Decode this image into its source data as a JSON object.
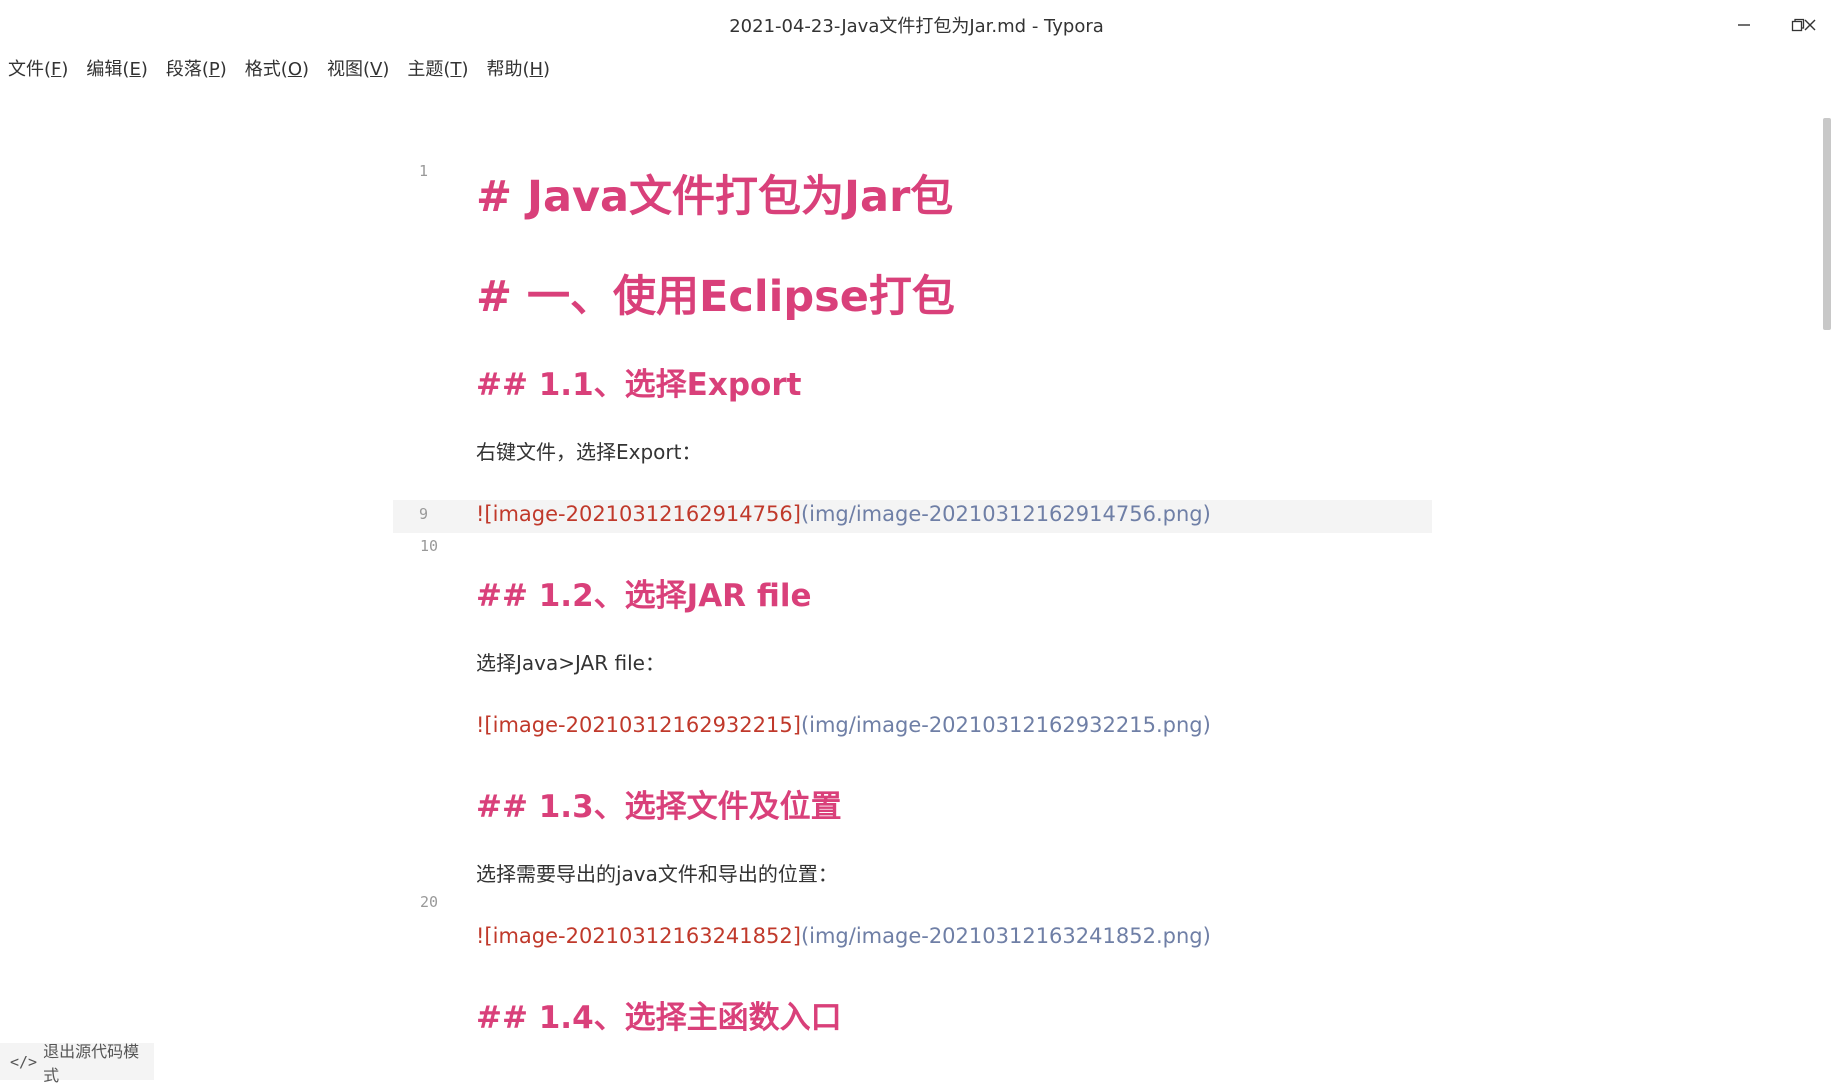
{
  "window": {
    "title": "2021-04-23-Java文件打包为Jar.md - Typora",
    "minimize_icon": "minimize-icon",
    "restore_icon": "restore-icon",
    "close_icon": "close-icon"
  },
  "menu": {
    "items": [
      {
        "label": "文件",
        "key": "F"
      },
      {
        "label": "编辑",
        "key": "E"
      },
      {
        "label": "段落",
        "key": "P"
      },
      {
        "label": "格式",
        "key": "O"
      },
      {
        "label": "视图",
        "key": "V"
      },
      {
        "label": "主题",
        "key": "T"
      },
      {
        "label": "帮助",
        "key": "H"
      }
    ]
  },
  "editor": {
    "line_numbers": [
      "1",
      "9",
      "10",
      "20"
    ],
    "lines": [
      {
        "type": "h1",
        "text": "# Java文件打包为Jar包"
      },
      {
        "type": "h1",
        "text": "# 一、使用Eclipse打包"
      },
      {
        "type": "h2",
        "text": "## 1.1、选择Export"
      },
      {
        "type": "p",
        "text": "右键文件，选择Export："
      },
      {
        "type": "img",
        "alt": "![image-20210312162914756]",
        "path": "(img/image-20210312162914756.png)"
      },
      {
        "type": "h2",
        "text": "## 1.2、选择JAR file"
      },
      {
        "type": "p",
        "text": "选择Java>JAR file："
      },
      {
        "type": "img",
        "alt": "![image-20210312162932215]",
        "path": "(img/image-20210312162932215.png)"
      },
      {
        "type": "h2",
        "text": "## 1.3、选择文件及位置"
      },
      {
        "type": "p",
        "text": "选择需要导出的java文件和导出的位置："
      },
      {
        "type": "img",
        "alt": "![image-20210312163241852]",
        "path": "(img/image-20210312163241852.png)"
      },
      {
        "type": "h2",
        "text": "## 1.4、选择主函数入口"
      }
    ]
  },
  "status": {
    "source_mode_label": "退出源代码模式",
    "source_mode_icon": "code-icon"
  },
  "colors": {
    "heading": "#d9407a",
    "img_alt": "#c0392b",
    "img_path": "#6f7fa6",
    "active_line": "#f4f4f4"
  }
}
